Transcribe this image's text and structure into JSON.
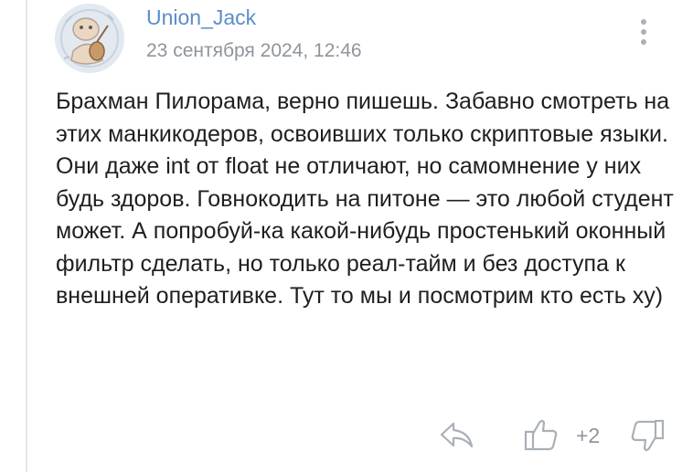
{
  "comment": {
    "username": "Union_Jack",
    "timestamp": "23 сентября 2024, 12:46",
    "text": "Брахман Пилорама, верно пишешь. Забавно смотреть на этих манкикодеров, освоивших только скриптовые языки. Они даже int от float не отличают, но самомнение у них будь здоров. Говнокодить на питоне — это любой студент может. А попробуй-ка какой-нибудь простенький оконный фильтр сделать, но только реал-тайм и без доступа к внешней оперативке. Тут то мы и посмотрим кто есть ху)",
    "likes": "+2"
  },
  "icons": {
    "menu": "vertical-dots-icon",
    "reply": "reply-arrow-icon",
    "like": "thumbs-up-icon",
    "dislike": "thumbs-down-icon"
  },
  "colors": {
    "username": "#5a8ec8",
    "meta": "#8e959c",
    "text": "#1f1f1f",
    "icons": "#a9b0b7"
  }
}
